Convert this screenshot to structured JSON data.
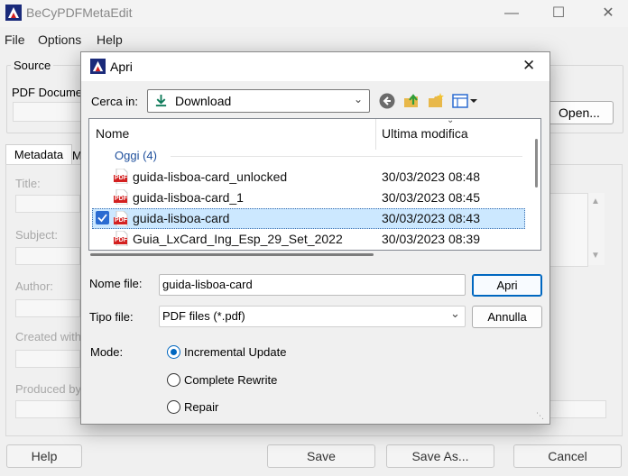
{
  "app": {
    "title": "BeCyPDFMetaEdit",
    "menu": [
      "File",
      "Options",
      "Help"
    ]
  },
  "main": {
    "source_group": "Source",
    "pdf_document_label": "PDF Documen",
    "open_button": "Open...",
    "tabs": [
      "Metadata",
      "M"
    ],
    "fields": [
      "Title:",
      "Subject:",
      "Author:",
      "Created with:",
      "Produced by"
    ],
    "bottom_buttons": {
      "help": "Help",
      "save": "Save",
      "save_as": "Save As...",
      "cancel": "Cancel"
    }
  },
  "dialog": {
    "title": "Apri",
    "look_in_label": "Cerca in:",
    "look_in_value": "Download",
    "toolbar_icons": [
      "back-icon",
      "up-folder-icon",
      "new-folder-icon",
      "view-menu-icon"
    ],
    "columns": {
      "name": "Nome",
      "modified": "Ultima modifica"
    },
    "group_label": "Oggi (4)",
    "files": [
      {
        "name": "guida-lisboa-card_unlocked",
        "modified": "30/03/2023 08:48",
        "selected": false
      },
      {
        "name": "guida-lisboa-card_1",
        "modified": "30/03/2023 08:45",
        "selected": false
      },
      {
        "name": "guida-lisboa-card",
        "modified": "30/03/2023 08:43",
        "selected": true
      },
      {
        "name": "Guia_LxCard_Ing_Esp_29_Set_2022",
        "modified": "30/03/2023 08:39",
        "selected": false
      }
    ],
    "filename_label": "Nome file:",
    "filename_value": "guida-lisboa-card",
    "filetype_label": "Tipo file:",
    "filetype_value": "PDF files (*.pdf)",
    "open_button": "Apri",
    "cancel_button": "Annulla",
    "mode_label": "Mode:",
    "modes": [
      {
        "label": "Incremental Update",
        "checked": true
      },
      {
        "label": "Complete Rewrite",
        "checked": false
      },
      {
        "label": "Repair",
        "checked": false
      }
    ],
    "pdf_badge": "PDF"
  },
  "colors": {
    "accent": "#0067c0",
    "selection_bg": "#cce8ff",
    "group_text": "#1e4f9c",
    "pdf_red": "#d32020"
  }
}
